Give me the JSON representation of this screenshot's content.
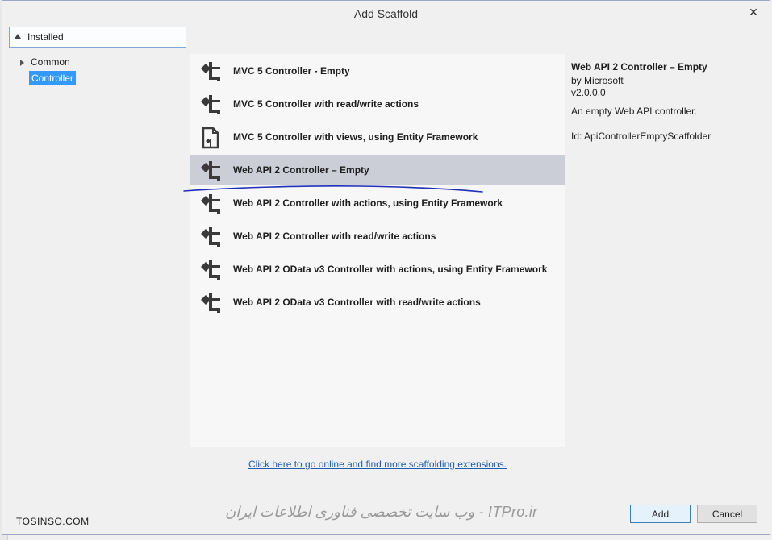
{
  "window": {
    "title": "Add Scaffold",
    "close_glyph": "✕"
  },
  "tree": {
    "header_label": "Installed",
    "items": [
      {
        "label": "Common"
      },
      {
        "label": "Controller",
        "selected": true
      }
    ]
  },
  "scaffolds": [
    {
      "name": "MVC 5 Controller - Empty",
      "icon": "controller-icon"
    },
    {
      "name": "MVC 5 Controller with read/write actions",
      "icon": "controller-icon"
    },
    {
      "name": "MVC 5 Controller with views, using Entity Framework",
      "icon": "controller-views-icon"
    },
    {
      "name": "Web API 2 Controller – Empty",
      "icon": "controller-icon",
      "selected": true
    },
    {
      "name": "Web API 2 Controller with actions, using Entity Framework",
      "icon": "controller-icon"
    },
    {
      "name": "Web API 2 Controller with read/write actions",
      "icon": "controller-icon"
    },
    {
      "name": "Web API 2 OData v3 Controller with actions, using Entity Framework",
      "icon": "controller-icon"
    },
    {
      "name": "Web API 2 OData v3 Controller with read/write actions",
      "icon": "controller-icon"
    }
  ],
  "details": {
    "title": "Web API 2 Controller – Empty",
    "author": "by Microsoft",
    "version": "v2.0.0.0",
    "description": "An empty Web API controller.",
    "id": "Id: ApiControllerEmptyScaffolder"
  },
  "link_text": "Click here to go online and find more scaffolding extensions.",
  "buttons": {
    "add": "Add",
    "cancel": "Cancel"
  },
  "watermarks": {
    "site": "TOSINSO.COM",
    "persian": "ITPro.ir - وب سایت تخصصی فناوری اطلاعات ایران"
  },
  "colors": {
    "selection": "#cbcdd7",
    "tree_selection": "#3399ff",
    "link": "#1c5fb0",
    "scribble": "#1f2fb8"
  }
}
